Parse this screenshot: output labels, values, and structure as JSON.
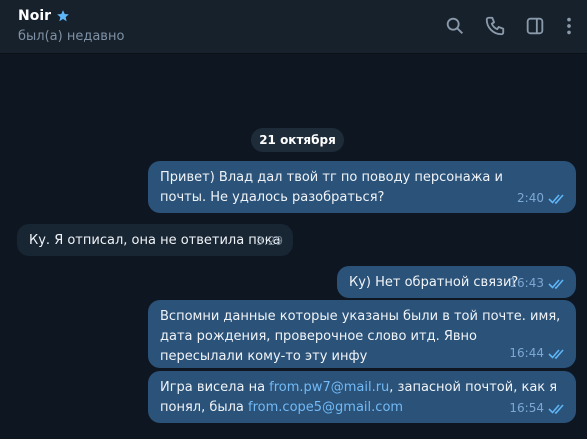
{
  "header": {
    "title": "Noir",
    "status": "был(а) недавно"
  },
  "icons": {
    "favorite": "star-icon",
    "search": "search-icon",
    "call": "phone-icon",
    "sidebar": "sidebar-toggle-icon",
    "menu": "more-vertical-icon",
    "read": "double-check-icon"
  },
  "colors": {
    "background": "#0e1621",
    "header": "#17212b",
    "outgoing_bubble": "#2b5278",
    "incoming_bubble": "#182533",
    "accent": "#5eb5f7",
    "link": "#71baf7"
  },
  "date_separator": "21 октября",
  "messages": [
    {
      "direction": "out",
      "text": "Привет) Влад дал твой тг по поводу персонажа и почты. Не удалось разобраться?",
      "time": "2:40",
      "read": true
    },
    {
      "direction": "in",
      "text": "Ку. Я отписал, она не ответила пока",
      "time": "3:29"
    },
    {
      "direction": "out",
      "text": "Ку) Нет обратной связи?",
      "time": "16:43",
      "read": true
    },
    {
      "direction": "out",
      "text": "Вспомни данные которые указаны были в той почте. имя, дата рождения, проверочное слово итд. Явно пересылали кому-то эту инфу",
      "time": "16:44",
      "read": true
    },
    {
      "direction": "out",
      "text_part1": "Игра висела на ",
      "link1": "from.pw7@mail.ru",
      "text_part2": ", запасной почтой, как я понял, была ",
      "link2": "from.cope5@gmail.com",
      "time": "16:54",
      "read": true
    }
  ]
}
